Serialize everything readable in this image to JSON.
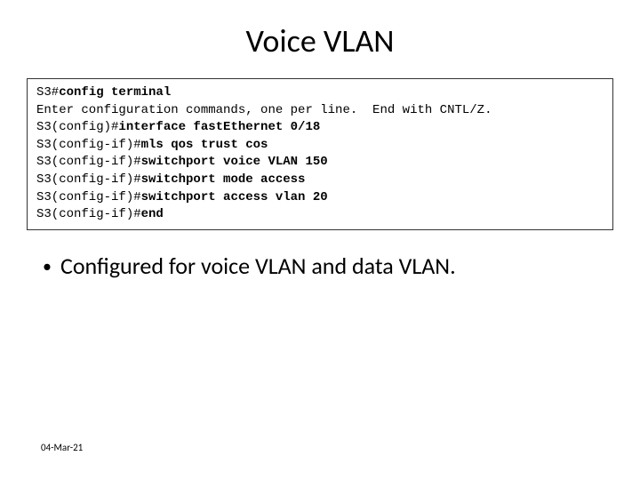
{
  "title": "Voice VLAN",
  "terminal": {
    "lines": [
      {
        "prompt": "S3#",
        "cmd": "config terminal"
      },
      {
        "prompt": "Enter configuration commands, one per line.  End with CNTL/Z.",
        "cmd": ""
      },
      {
        "prompt": "S3(config)#",
        "cmd": "interface fastEthernet 0/18"
      },
      {
        "prompt": "S3(config-if)#",
        "cmd": "mls qos trust cos"
      },
      {
        "prompt": "S3(config-if)#",
        "cmd": "switchport voice VLAN 150"
      },
      {
        "prompt": "S3(config-if)#",
        "cmd": "switchport mode access"
      },
      {
        "prompt": "S3(config-if)#",
        "cmd": "switchport access vlan 20"
      },
      {
        "prompt": "S3(config-if)#",
        "cmd": "end"
      }
    ]
  },
  "bullets": [
    "Configured for voice VLAN and data VLAN."
  ],
  "footer_date": "04-Mar-21"
}
